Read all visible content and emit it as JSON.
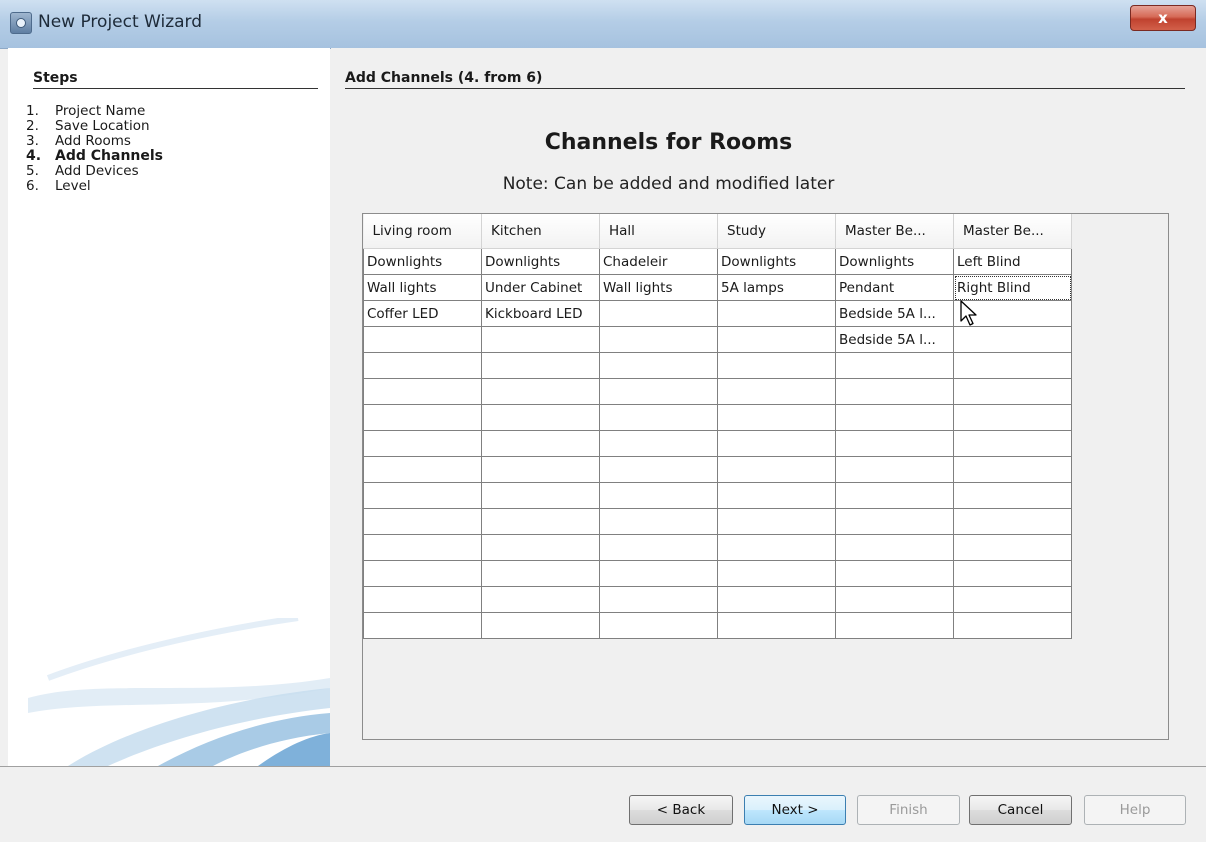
{
  "window": {
    "title": "New Project Wizard",
    "close_label": "x"
  },
  "steps": {
    "heading": "Steps",
    "items": [
      {
        "num": "1.",
        "label": "Project Name"
      },
      {
        "num": "2.",
        "label": "Save Location"
      },
      {
        "num": "3.",
        "label": "Add Rooms"
      },
      {
        "num": "4.",
        "label": "Add Channels",
        "active": true
      },
      {
        "num": "5.",
        "label": "Add Devices"
      },
      {
        "num": "6.",
        "label": "Level"
      }
    ]
  },
  "main": {
    "step_header": "Add Channels (4. from 6)",
    "title": "Channels for Rooms",
    "note": "Note: Can be added and modified later"
  },
  "table": {
    "columns": [
      "Living room",
      "Kitchen",
      "Hall",
      "Study",
      "Master Be...",
      "Master Be..."
    ],
    "rows": [
      [
        "Downlights",
        "Downlights",
        "Chadeleir",
        "Downlights",
        "Downlights",
        "Left Blind"
      ],
      [
        "Wall lights",
        "Under Cabinet",
        "Wall lights",
        "5A lamps",
        "Pendant",
        "Right Blind"
      ],
      [
        "Coffer LED",
        "Kickboard LED",
        "",
        "",
        "Bedside 5A l...",
        ""
      ],
      [
        "",
        "",
        "",
        "",
        "Bedside 5A l...",
        ""
      ],
      [
        "",
        "",
        "",
        "",
        "",
        ""
      ],
      [
        "",
        "",
        "",
        "",
        "",
        ""
      ],
      [
        "",
        "",
        "",
        "",
        "",
        ""
      ],
      [
        "",
        "",
        "",
        "",
        "",
        ""
      ],
      [
        "",
        "",
        "",
        "",
        "",
        ""
      ],
      [
        "",
        "",
        "",
        "",
        "",
        ""
      ],
      [
        "",
        "",
        "",
        "",
        "",
        ""
      ],
      [
        "",
        "",
        "",
        "",
        "",
        ""
      ],
      [
        "",
        "",
        "",
        "",
        "",
        ""
      ],
      [
        "",
        "",
        "",
        "",
        "",
        ""
      ],
      [
        "",
        "",
        "",
        "",
        "",
        ""
      ]
    ]
  },
  "buttons": {
    "back": "< Back",
    "next": "Next >",
    "finish": "Finish",
    "cancel": "Cancel",
    "help": "Help"
  }
}
